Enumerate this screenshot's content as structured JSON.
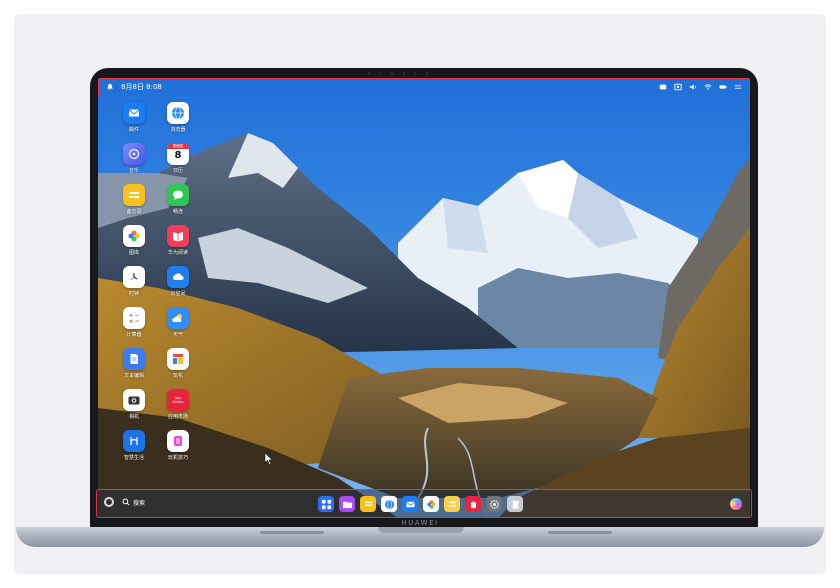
{
  "statusbar": {
    "datetime": "8月8日 8:08",
    "icons": [
      "notification-bell-icon",
      "screen-share-icon",
      "screenshot-icon",
      "volume-icon",
      "wifi-icon",
      "battery-icon",
      "control-center-icon"
    ]
  },
  "desktop_icons": [
    {
      "name": "mail",
      "label": "邮件",
      "icon": "mail-icon",
      "color": "#1d7cf2"
    },
    {
      "name": "browser",
      "label": "浏览器",
      "icon": "globe-icon",
      "color": "#2b8de8"
    },
    {
      "name": "music",
      "label": "音乐",
      "icon": "music-icon",
      "color": "#5b6cf0"
    },
    {
      "name": "calendar",
      "label": "日历",
      "icon": "calendar-icon",
      "color": "#ffffff",
      "day": "8",
      "month": "星期四"
    },
    {
      "name": "memo",
      "label": "备忘录",
      "icon": "memo-icon",
      "color": "#f7c21b"
    },
    {
      "name": "messages",
      "label": "畅连",
      "icon": "chat-icon",
      "color": "#2fc655"
    },
    {
      "name": "gallery",
      "label": "图库",
      "icon": "gallery-icon",
      "color": "#ffffff"
    },
    {
      "name": "books",
      "label": "华为阅读",
      "icon": "book-icon",
      "color": "#ef3e5b"
    },
    {
      "name": "clock",
      "label": "时钟",
      "icon": "clock-icon",
      "color": "#ffffff"
    },
    {
      "name": "cloud",
      "label": "云空间",
      "icon": "cloud-icon",
      "color": "#1f7df0"
    },
    {
      "name": "calculator",
      "label": "计算器",
      "icon": "calculator-icon",
      "color": "#ffffff"
    },
    {
      "name": "weather",
      "label": "天气",
      "icon": "weather-icon",
      "color": "#2f8ff7"
    },
    {
      "name": "text-editor",
      "label": "文本编辑",
      "icon": "document-icon",
      "color": "#3b7cf5"
    },
    {
      "name": "tips",
      "label": "玩机",
      "icon": "tips-icon",
      "color": "#ffffff"
    },
    {
      "name": "camera",
      "label": "相机",
      "icon": "camera-icon",
      "color": "#ffffff"
    },
    {
      "name": "appgallery",
      "label": "应用市场",
      "icon": "appgallery-icon",
      "color": "#e8243c",
      "badge": "App Gallery"
    },
    {
      "name": "smart-life",
      "label": "智慧生活",
      "icon": "smart-life-icon",
      "color": "#1f73e8"
    },
    {
      "name": "tips2",
      "label": "玩机技巧",
      "icon": "tips2-icon",
      "color": "#ffffff"
    }
  ],
  "dock": {
    "search_label": "搜索",
    "apps": [
      {
        "name": "launcher",
        "icon": "launcher-icon",
        "color": "#2e6ef5"
      },
      {
        "name": "files",
        "icon": "folder-icon",
        "color": "#a64cf0"
      },
      {
        "name": "notes",
        "icon": "memo-icon",
        "color": "#f7c21b"
      },
      {
        "name": "browser",
        "icon": "globe-icon",
        "color": "#2b8de8"
      },
      {
        "name": "mail",
        "icon": "mail-icon",
        "color": "#1d7cf2"
      },
      {
        "name": "gallery",
        "icon": "gallery-icon",
        "color": "#ffffff"
      },
      {
        "name": "memo",
        "icon": "memo-icon",
        "color": "#f5d24a"
      },
      {
        "name": "appgallery",
        "icon": "appgallery-icon",
        "color": "#e8243c"
      },
      {
        "name": "settings",
        "icon": "gear-icon",
        "color": "#6f747e"
      },
      {
        "name": "trash",
        "icon": "trash-icon",
        "color": "#c9ccd2"
      }
    ]
  },
  "device_brand": "HUAWEI",
  "colors": {
    "highlight": "#e8334a",
    "sky": "#2f7ee0"
  }
}
